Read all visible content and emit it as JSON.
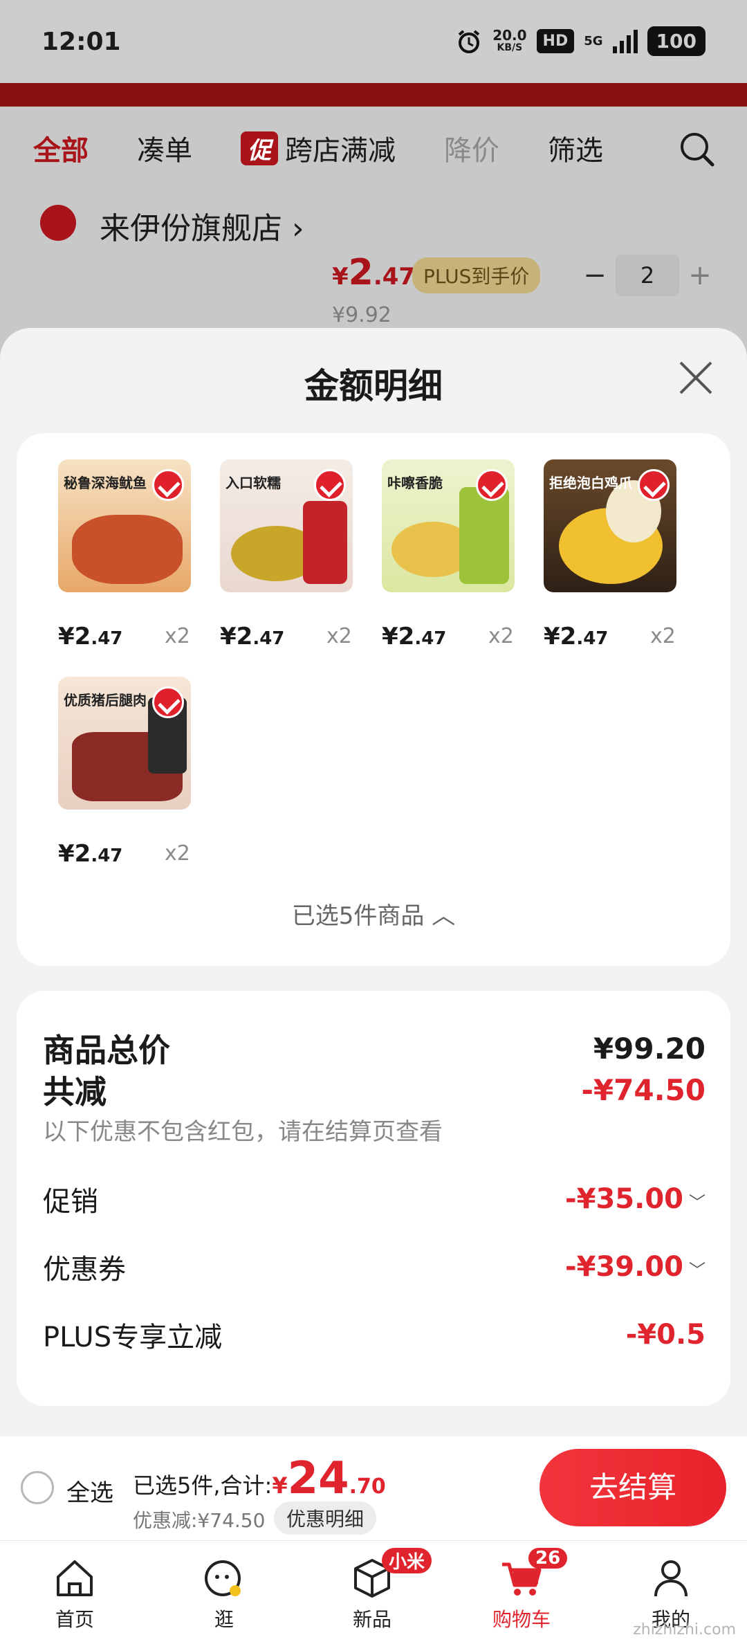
{
  "status_bar": {
    "time": "12:01",
    "speed": "20.0",
    "speed_unit": "KB/S",
    "hd": "HD",
    "network": "5G",
    "battery": "100"
  },
  "tabs": {
    "all": "全部",
    "bundle": "凑单",
    "promo_tag": "促",
    "cross_store": "跨店满减",
    "price_drop": "降价",
    "filter": "筛选"
  },
  "store": {
    "name": "来伊份旗舰店",
    "arrow": "›",
    "price_symbol": "¥",
    "price_int": "2",
    "price_dec": ".47",
    "plus_label": "PLUS到手价",
    "original_price": "¥9.92",
    "qty": "2",
    "minus": "−",
    "plus": "+"
  },
  "sheet": {
    "title": "金额明细",
    "selected_count": "已选5件商品 ︿"
  },
  "items": [
    {
      "label": "秘鲁深海鱿鱼",
      "price_int": "¥2",
      "price_dec": ".47",
      "qty": "x2"
    },
    {
      "label": "入口软糯",
      "price_int": "¥2",
      "price_dec": ".47",
      "qty": "x2"
    },
    {
      "label": "咔嚓香脆",
      "price_int": "¥2",
      "price_dec": ".47",
      "qty": "x2"
    },
    {
      "label": "拒绝泡白鸡爪",
      "price_int": "¥2",
      "price_dec": ".47",
      "qty": "x2"
    },
    {
      "label": "优质猪后腿肉",
      "price_int": "¥2",
      "price_dec": ".47",
      "qty": "x2"
    }
  ],
  "summary": {
    "total_label": "商品总价",
    "total_value": "¥99.20",
    "reduce_label": "共减",
    "reduce_value": "-¥74.50",
    "note": "以下优惠不包含红包，请在结算页查看",
    "promo_label": "促销",
    "promo_value": "-¥35.00",
    "coupon_label": "优惠券",
    "coupon_value": "-¥39.00",
    "plus_label": "PLUS专享立减",
    "plus_value": "-¥0.5"
  },
  "checkout": {
    "select_all": "全选",
    "selected_text": "已选5件,合计:",
    "amount_symbol": "¥",
    "amount_int": "24",
    "amount_dec": ".70",
    "discount_text": "优惠减:¥74.50",
    "detail_button": "优惠明细",
    "pay_button": "去结算"
  },
  "tabbar": {
    "home": "首页",
    "browse": "逛",
    "new": "新品",
    "new_badge": "小米",
    "cart": "购物车",
    "cart_badge": "26",
    "mine": "我的"
  },
  "watermark": "zhizhizhi.com",
  "colors": {
    "accent": "#e0242e",
    "dim_accent": "#a8141a"
  }
}
